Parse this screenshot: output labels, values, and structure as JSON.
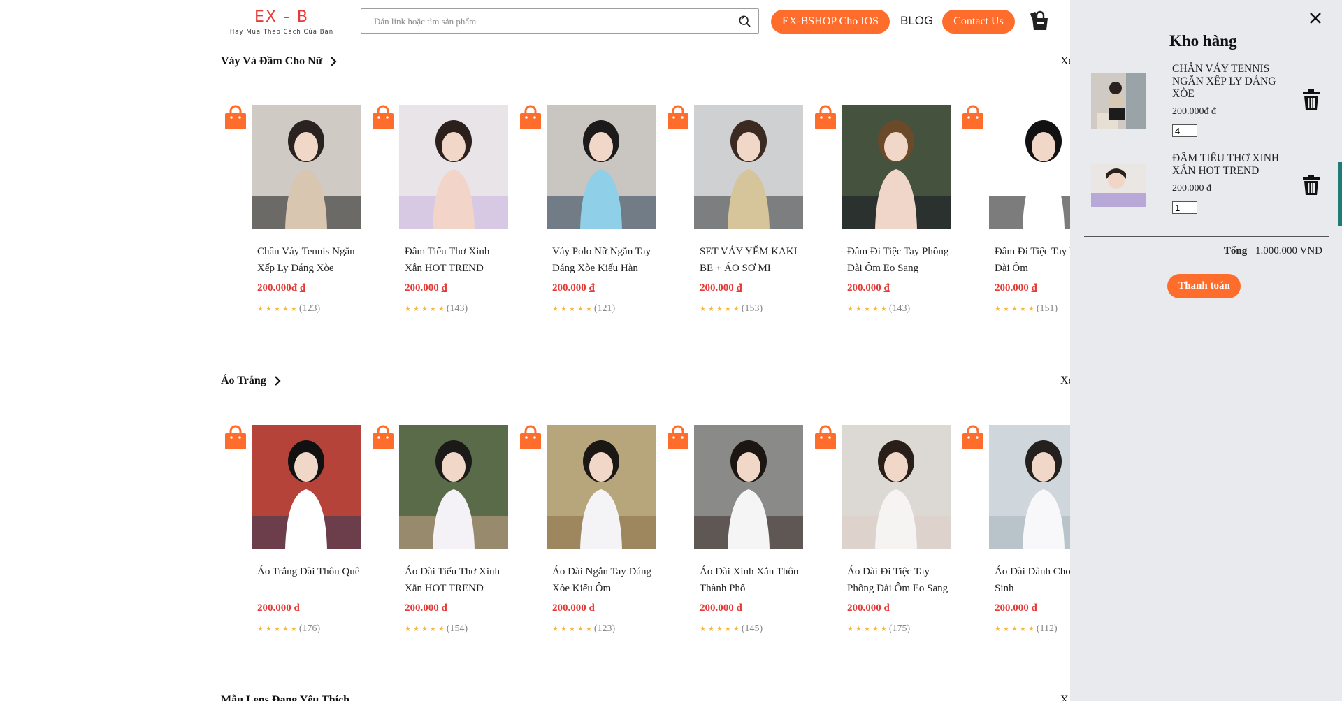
{
  "header": {
    "logo_title": "EX - B",
    "logo_subtitle": "Hãy Mua Theo Cách Của Bạn",
    "search_placeholder": "Dán link hoặc tìm sản phẩm",
    "ios_button": "EX-BSHOP Cho IOS",
    "blog_link": "BLOG",
    "contact_button": "Contact Us"
  },
  "sections": [
    {
      "title": "Váy Và Đầm Cho Nữ",
      "more": "Xe",
      "products": [
        {
          "name": "Chân Váy Tennis Ngắn Xếp Ly Dáng Xòe",
          "price": "200.000đ",
          "currency": "đ",
          "reviews": "(123)"
        },
        {
          "name": "Đầm Tiểu Thơ Xinh Xắn HOT TREND",
          "price": "200.000",
          "currency": "đ",
          "reviews": "(143)"
        },
        {
          "name": "Váy Polo Nữ Ngắn Tay Dáng Xòe Kiểu Hàn",
          "price": "200.000",
          "currency": "đ",
          "reviews": "(121)"
        },
        {
          "name": "SET VÁY YẾM KAKI BE + ÁO SƠ MI",
          "price": "200.000",
          "currency": "đ",
          "reviews": "(153)"
        },
        {
          "name": "Đầm Đi Tiệc Tay Phồng Dài Ôm Eo Sang",
          "price": "200.000",
          "currency": "đ",
          "reviews": "(143)"
        },
        {
          "name": "Đầm Đi Tiệc Tay Phồng Dài Ôm",
          "price": "200.000",
          "currency": "đ",
          "reviews": "(151)"
        }
      ]
    },
    {
      "title": "Áo Trắng",
      "more": "Xe",
      "products": [
        {
          "name": "Áo Trắng Dài Thôn Quê",
          "price": "200.000",
          "currency": "đ",
          "reviews": "(176)"
        },
        {
          "name": "Áo Dài Tiểu Thơ Xinh Xắn HOT TREND",
          "price": "200.000",
          "currency": "đ",
          "reviews": "(154)"
        },
        {
          "name": "Áo Dài Ngắn Tay Dáng Xòe Kiểu Ôm",
          "price": "200.000",
          "currency": "đ",
          "reviews": "(123)"
        },
        {
          "name": "Áo Dài Xinh Xắn Thôn Thành Phố",
          "price": "200.000",
          "currency": "đ",
          "reviews": "(145)"
        },
        {
          "name": "Áo Dài Đi Tiệc Tay Phồng Dài Ôm Eo Sang",
          "price": "200.000",
          "currency": "đ",
          "reviews": "(175)"
        },
        {
          "name": "Áo Dài Dành Cho Học Sinh",
          "price": "200.000",
          "currency": "đ",
          "reviews": "(112)"
        }
      ]
    },
    {
      "title": "Mẫu Lens Đang Yêu Thích",
      "more": "X"
    }
  ],
  "cart": {
    "title": "Kho hàng",
    "items": [
      {
        "name": "CHÂN VÁY TENNIS NGẮN XẾP LY DÁNG XÒE",
        "price": "200.000đ đ",
        "quantity": "4"
      },
      {
        "name": "ĐẦM TIỂU THƠ XINH XẮN HOT TREND",
        "price": "200.000 đ",
        "quantity": "1"
      }
    ],
    "total_label": "Tổng",
    "total_value": "1.000.000 VND",
    "checkout_button": "Thanh toán"
  },
  "colors": {
    "accent": "#ff6d2c",
    "price": "#e53935",
    "star": "#f5b942",
    "panel_bg": "#e8eaed"
  },
  "icons": {
    "search": "search-icon",
    "cart": "shopping-bag-icon",
    "close": "close-icon",
    "trash": "trash-icon",
    "chevron": "chevron-right-icon"
  }
}
